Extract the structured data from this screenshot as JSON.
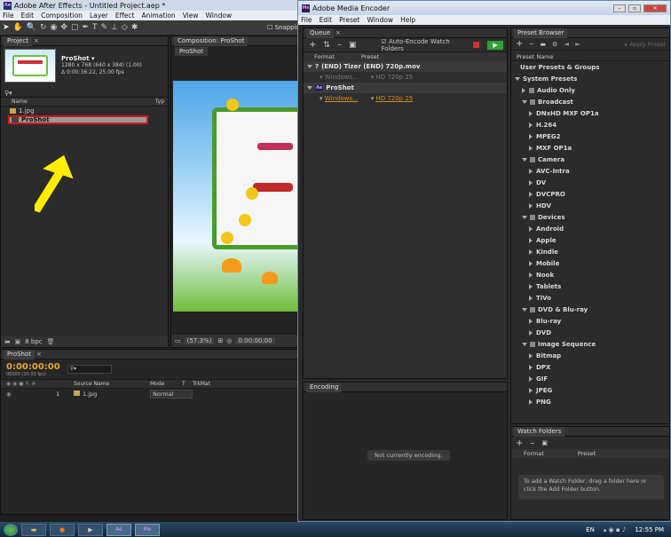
{
  "ae": {
    "title": "Adobe After Effects - Untitled Project.aep *",
    "menu": [
      "File",
      "Edit",
      "Composition",
      "Layer",
      "Effect",
      "Animation",
      "View",
      "Window"
    ],
    "project_tab": "Project",
    "comp_name": "ProShot",
    "comp_res": "1280 x 768  (640 x 384) (1.00)",
    "comp_dur": "Δ 0:00:36:22, 25.00 fps",
    "col_name": "Name",
    "col_type": "Typ",
    "item1": "1.jpg",
    "item2": "ProShot",
    "bpc": "8 bpc",
    "comp_tab": "Composition: ProShot",
    "comp_subtab": "ProShot",
    "zoom": "(57.3%)",
    "timecode": "0:00:00:00",
    "snapping": "Snappin",
    "timeline_tab": "ProShot",
    "tl_time": "0:00:00:00",
    "tl_frames": "00000 (25.00 fps)",
    "tl_search": "",
    "tl_cols": {
      "source": "Source Name",
      "mode": "Mode",
      "t": "T",
      "trkmat": "TrkMat"
    },
    "layer_num": "1",
    "layer_name": "1.jpg",
    "layer_mode": "Normal"
  },
  "ame": {
    "title": "Adobe Media Encoder",
    "menu": [
      "File",
      "Edit",
      "Preset",
      "Window",
      "Help"
    ],
    "queue_tab": "Queue",
    "watch_label": "Auto-Encode Watch Folders",
    "col_format": "Format",
    "col_preset": "Preset",
    "item1_name": "(END) Tizer (END) 720p.mov",
    "item1_format": "Windows...",
    "item1_preset": "HD 720p 25",
    "item2_name": "ProShot",
    "item2_format": "Windows...",
    "item2_preset": "HD 720p 25",
    "encoding_tab": "Encoding",
    "not_encoding": "Not currently encoding.",
    "preset_tab": "Preset Browser",
    "apply_preset": "Apply Preset",
    "preset_col": "Preset Name",
    "user_presets": "User Presets & Groups",
    "system_presets": "System Presets",
    "groups": [
      {
        "name": "Audio Only",
        "items": []
      },
      {
        "name": "Broadcast",
        "items": [
          "DNxHD MXF OP1a",
          "H.264",
          "MPEG2",
          "MXF OP1a"
        ]
      },
      {
        "name": "Camera",
        "items": [
          "AVC-Intra",
          "DV",
          "DVCPRO",
          "HDV"
        ]
      },
      {
        "name": "Devices",
        "items": [
          "Android",
          "Apple",
          "Kindle",
          "Mobile",
          "Nook",
          "Tablets",
          "TiVo"
        ]
      },
      {
        "name": "DVD & Blu-ray",
        "items": [
          "Blu-ray",
          "DVD"
        ]
      },
      {
        "name": "Image Sequence",
        "items": [
          "Bitmap",
          "DPX",
          "GIF",
          "JPEG",
          "PNG"
        ]
      }
    ],
    "watch_tab": "Watch Folders",
    "wf_format": "Format",
    "wf_preset": "Preset",
    "wf_msg": "To add a Watch Folder, drag a folder here or click the Add Folder button."
  },
  "taskbar": {
    "lang": "EN",
    "time": "12:55 PM"
  },
  "colors": {
    "highlight_red": "#d01818",
    "arrow": "#ffee00",
    "orange_text": "#d38a1a",
    "play_green": "#2fa32f"
  }
}
